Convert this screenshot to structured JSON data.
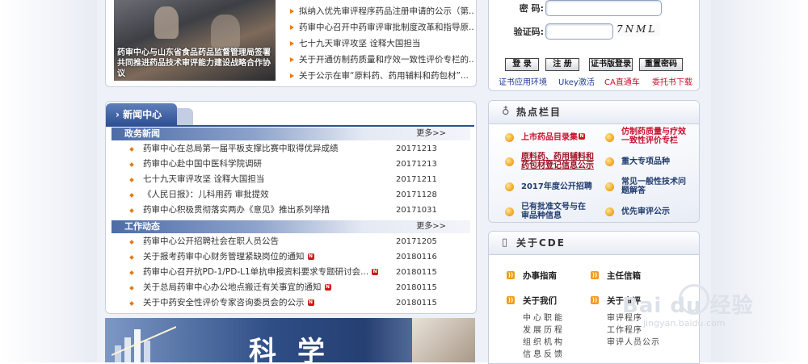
{
  "feature": {
    "caption": "药审中心与山东省食品药品监督管理局签署共同推进药品技术审评能力建设战略合作协议",
    "items": [
      "拟纳入优先审评程序药品注册申请的公示（第...",
      "药审中心召开中药审评审批制度改革和指导原...",
      "七十九天审评攻坚  诠释大国担当",
      "关于开通仿制药质量和疗效一致性评价专栏的...",
      "关于公示在审“原料药、药用辅料和药包材”..."
    ]
  },
  "login": {
    "password_label": "密  码:",
    "captcha_label": "验证码:",
    "captcha_value": "7NML",
    "buttons": [
      "登 录",
      "注 册",
      "证书版登录",
      "重置密码"
    ],
    "links": [
      "证书应用环境",
      "Ukey激活",
      "CA直通车",
      "委托书下载"
    ]
  },
  "news": {
    "tab_label": "新闻中心",
    "more": "更多>>",
    "sections": [
      {
        "title": "政务新闻",
        "items": [
          {
            "title": "药审中心在总局第一届平板支撑比赛中取得优异成绩",
            "date": "20171213"
          },
          {
            "title": "药审中心赴中国中医科学院调研",
            "date": "20171213"
          },
          {
            "title": "七十九天审评攻坚  诠释大国担当",
            "date": "20171211"
          },
          {
            "title": "《人民日报》：儿科用药 审批提效",
            "date": "20171128"
          },
          {
            "title": "药审中心积极贯彻落实两办《意见》推出系列举措",
            "date": "20171031"
          }
        ]
      },
      {
        "title": "工作动态",
        "items": [
          {
            "title": "药审中心公开招聘社会在职人员公告",
            "date": "20171205"
          },
          {
            "title": "关于报考药审中心财务管理紧缺岗位的通知",
            "date": "20180116"
          },
          {
            "title": "药审中心召开抗PD-1/PD-L1单抗申报资料要求专题研讨会...",
            "date": "20180115"
          },
          {
            "title": "关于总局药审中心办公地点搬迁有关事宜的通知",
            "date": "20180115"
          },
          {
            "title": "关于中药安全性评价专家咨询委员会的公示",
            "date": "20180115"
          }
        ]
      }
    ]
  },
  "banner": {
    "text": "科学"
  },
  "hot": {
    "title": "热点栏目",
    "items": [
      {
        "label": "上市药品目录集",
        "color": "#c8102e"
      },
      {
        "label": "仿制药质量与疗效一致性评价专栏",
        "color": "#c8102e"
      },
      {
        "label": "原料药、药用辅料和药包材登记信息公示",
        "color": "#9b0d1e"
      },
      {
        "label": "重大专项品种",
        "color": "#1f3b70"
      },
      {
        "label": "2017年度公开招聘",
        "color": "#1f3b70"
      },
      {
        "label": "常见一般性技术问题解答",
        "color": "#1f3b70"
      },
      {
        "label": "已有批准文号与在审品种信息",
        "color": "#1f3b70"
      },
      {
        "label": "优先审评公示",
        "color": "#1f3b70"
      }
    ]
  },
  "about": {
    "title": "关于CDE",
    "items": [
      "办事指南",
      "主任信箱",
      "关于我们",
      "关于审评"
    ],
    "sub_left": [
      "中心职能",
      "发展历程",
      "组织机构",
      "信息反馈"
    ],
    "sub_right": [
      "审评程序",
      "工作程序",
      "审评人员公示"
    ]
  },
  "watermark": {
    "brand": "Bai du 经验",
    "url": "jingyan.baidu.com"
  },
  "new_badge": "N"
}
